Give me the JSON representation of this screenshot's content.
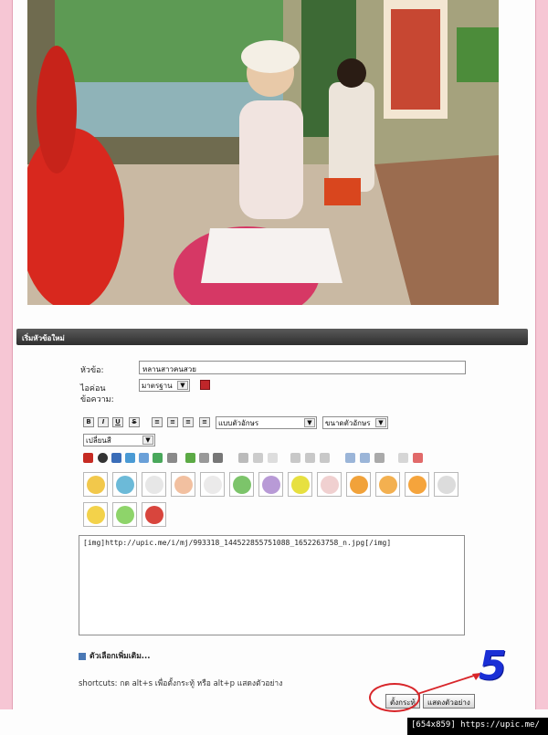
{
  "panel": {
    "title": "เริ่มหัวข้อใหม่"
  },
  "form": {
    "subject_label": "หัวข้อ:",
    "subject_value": "หลานสาวคนสวย",
    "icon_label_1": "ไอค่อน",
    "icon_label_2": "ข้อความ:",
    "icon_select": "มาตรฐาน"
  },
  "toolbar": {
    "bold": "B",
    "italic": "I",
    "underline": "U",
    "strike": "S",
    "font_face": "แบบตัวอักษร",
    "font_size": "ขนาดตัวอักษร",
    "color": "เปลี่ยนสี"
  },
  "message_body": "[img]http://upic.me/i/mj/993318_144522855751088_1652263758_n.jpg[/img]",
  "more_options": "ตัวเลือกเพิ่มเติม...",
  "shortcuts": "shortcuts: กด alt+s เพื่อตั้งกระทู้ หรือ alt+p แสดงตัวอย่าง",
  "buttons": {
    "post": "ตั้งกระทู้",
    "preview": "แสดงตัวอย่าง"
  },
  "annotation": {
    "step_number": "5",
    "arrow_color": "#d8262a",
    "number_color": "#1a2fd6"
  },
  "footer": "[654x859] https://upic.me/"
}
